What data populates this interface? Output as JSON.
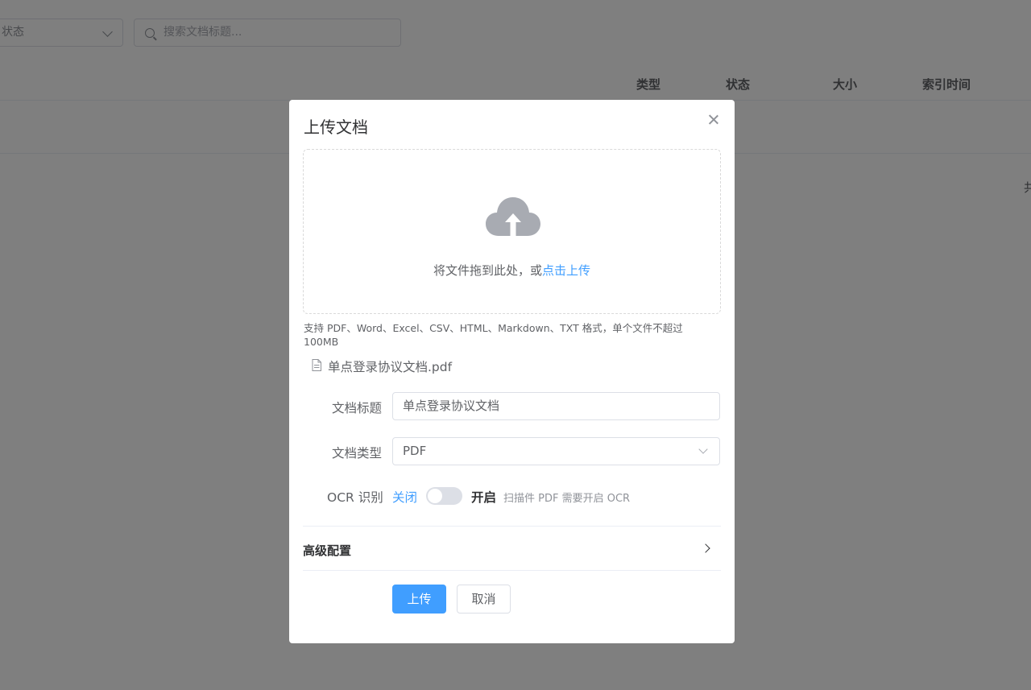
{
  "background": {
    "status_filter": {
      "value": "状态"
    },
    "search": {
      "placeholder": "搜索文档标题..."
    },
    "table_headers": [
      "类型",
      "状态",
      "大小",
      "索引时间"
    ],
    "edge_glyph": "共"
  },
  "dialog": {
    "title": "上传文档",
    "dropzone": {
      "text": "将文件拖到此处，或",
      "link": "点击上传"
    },
    "tip": "支持 PDF、Word、Excel、CSV、HTML、Markdown、TXT 格式，单个文件不超过 100MB",
    "file": {
      "name": "单点登录协议文档.pdf",
      "icon": "document-icon"
    },
    "form": {
      "title_label": "文档标题",
      "title_value": "单点登录协议文档",
      "type_label": "文档类型",
      "type_value": "PDF",
      "ocr_label": "OCR 识别",
      "ocr_off": "关闭",
      "ocr_on": "开启",
      "ocr_enabled": false,
      "ocr_hint": "扫描件 PDF 需要开启 OCR"
    },
    "advanced": {
      "label": "高级配置"
    },
    "buttons": {
      "upload": "上传",
      "cancel": "取消"
    }
  },
  "colors": {
    "primary": "#409eff",
    "overlay": "rgba(0,0,0,0.5)",
    "cloud": "#a8abb2"
  }
}
